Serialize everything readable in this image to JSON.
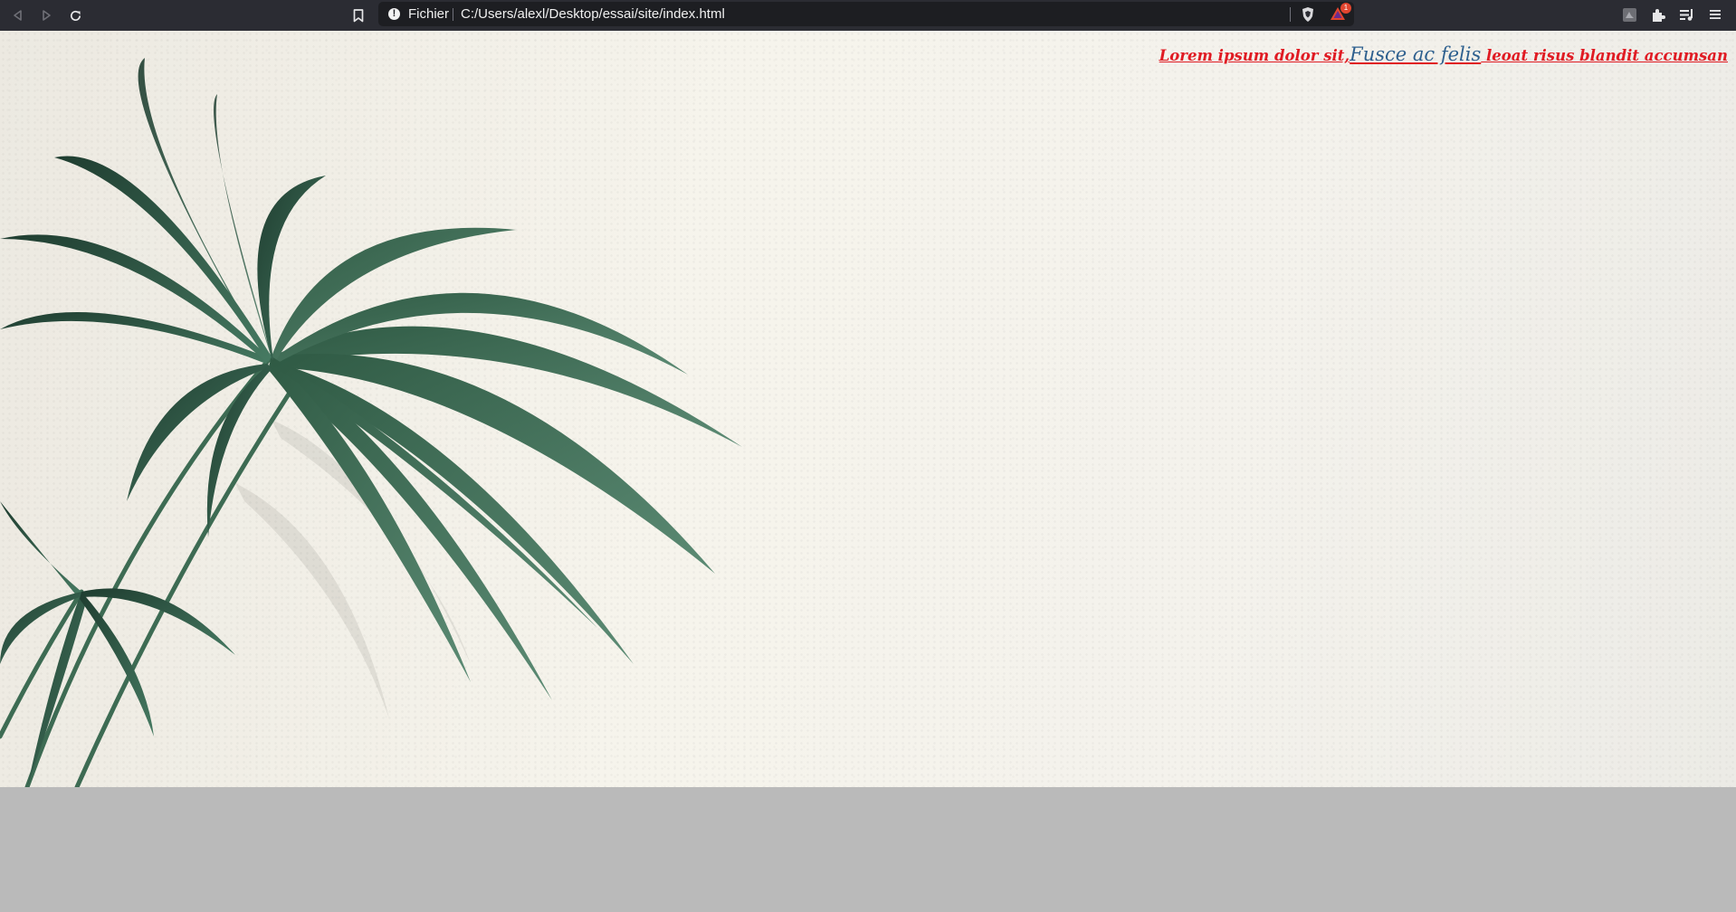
{
  "browser": {
    "protocol_label": "Fichier",
    "url": "C:/Users/alexl/Desktop/essai/site/index.html",
    "rewards_badge": "1",
    "icons": [
      "back-icon",
      "forward-icon",
      "reload-icon",
      "bookmark-icon",
      "info-icon",
      "brave-shield-icon",
      "brave-rewards-icon",
      "wallet-icon",
      "extensions-icon",
      "playlist-icon",
      "menu-icon"
    ]
  },
  "page": {
    "line_part1": "Lorem ipsum dolor sit,",
    "line_part2": "Fusce ac felis",
    "line_part3": " leoat risus blandit accumsan",
    "colors": {
      "red_text": "#e01b23",
      "blue_text": "#2d5f8e",
      "page_background": "#f4f2ec",
      "below_content": "#bababa"
    }
  }
}
